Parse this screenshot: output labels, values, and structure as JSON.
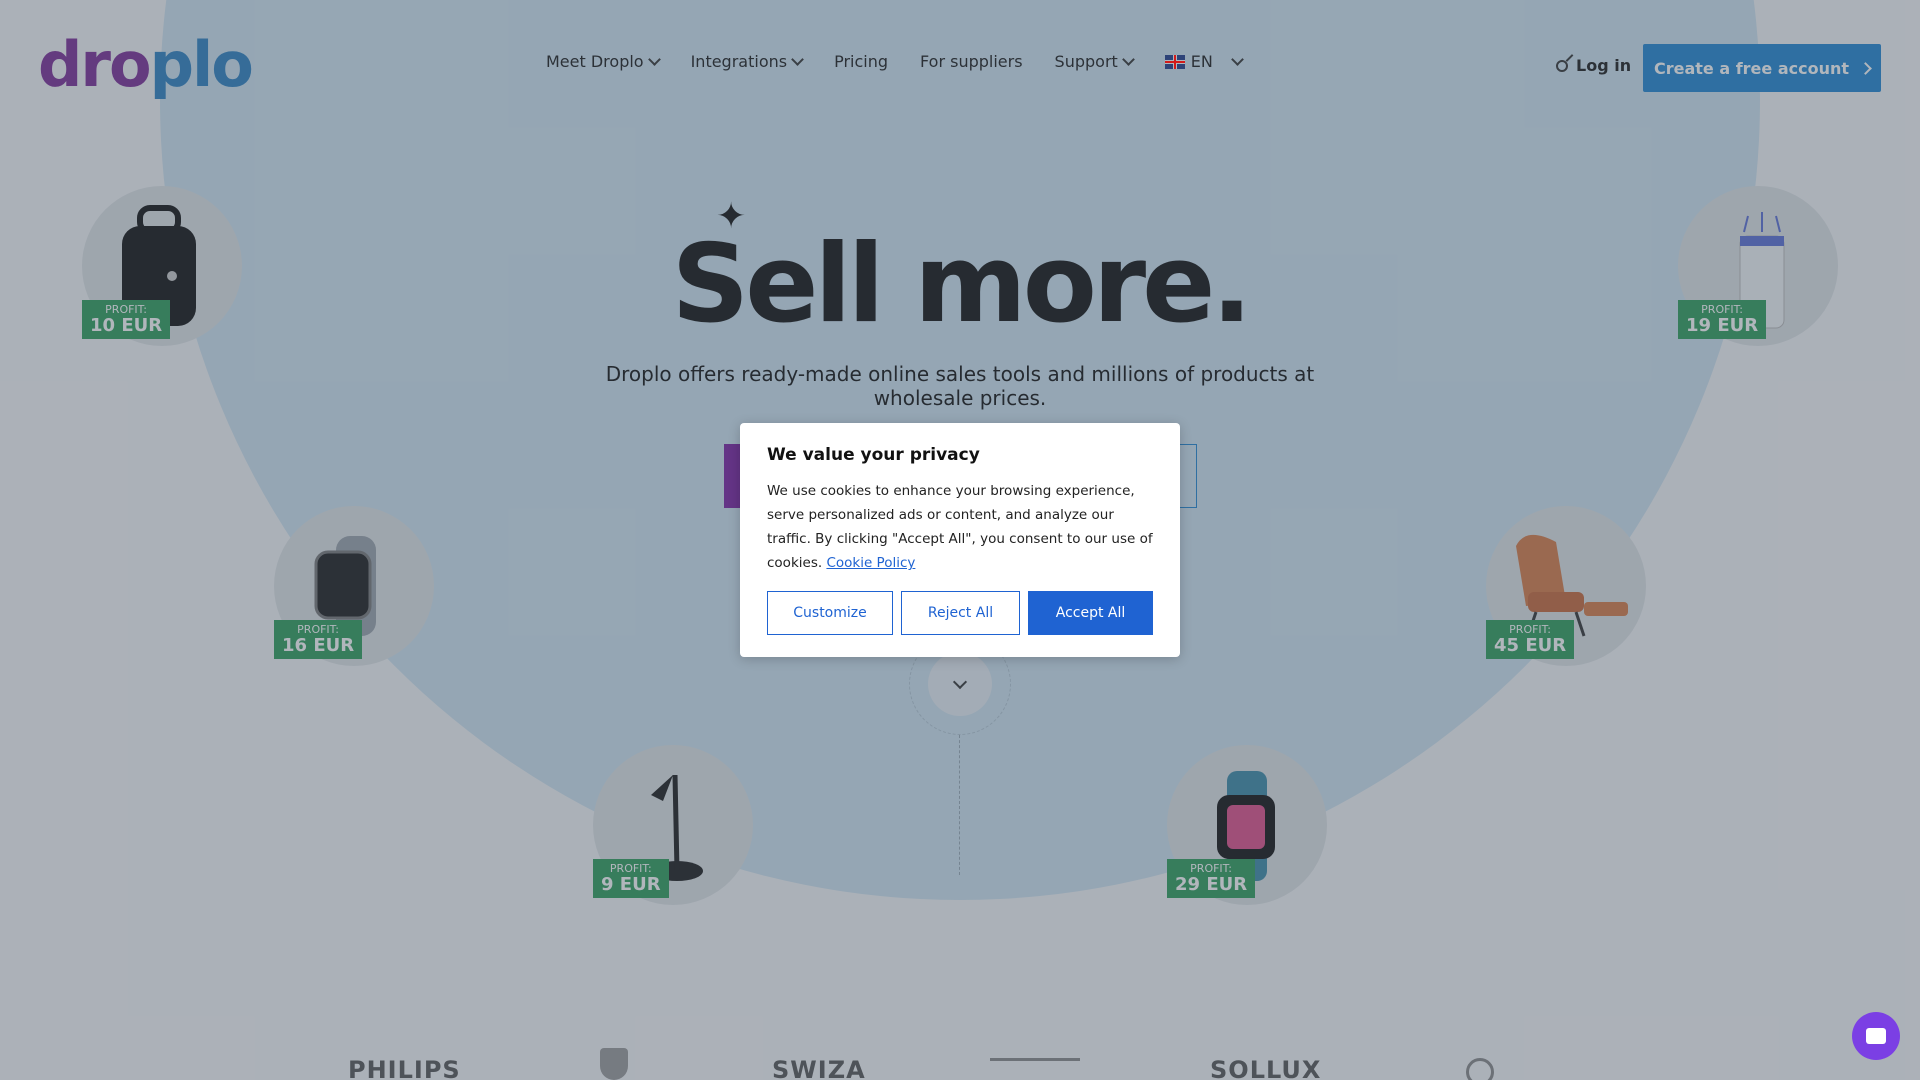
{
  "header": {
    "logo": {
      "part1": "dro",
      "part2": "plo"
    },
    "nav": [
      {
        "label": "Meet Droplo",
        "has_dropdown": true
      },
      {
        "label": "Integrations",
        "has_dropdown": true
      },
      {
        "label": "Pricing",
        "has_dropdown": false
      },
      {
        "label": "For suppliers",
        "has_dropdown": false
      },
      {
        "label": "Support",
        "has_dropdown": true
      }
    ],
    "language": "EN",
    "login_label": "Log in",
    "cta_label": "Create a free account"
  },
  "hero": {
    "title": "Sell more.",
    "subtitle": "Droplo offers ready-made online sales tools and millions of products at wholesale prices."
  },
  "products": [
    {
      "name": "backpack",
      "profit_label": "PROFIT:",
      "profit_value": "10 EUR"
    },
    {
      "name": "air purifier",
      "profit_label": "PROFIT:",
      "profit_value": "19 EUR"
    },
    {
      "name": "smartwatch grey",
      "profit_label": "PROFIT:",
      "profit_value": "16 EUR"
    },
    {
      "name": "armchair",
      "profit_label": "PROFIT:",
      "profit_value": "45 EUR"
    },
    {
      "name": "desk lamp",
      "profit_label": "PROFIT:",
      "profit_value": "9 EUR"
    },
    {
      "name": "smartwatch blue",
      "profit_label": "PROFIT:",
      "profit_value": "29 EUR"
    }
  ],
  "brands": [
    "PHILIPS",
    "SWIZA",
    "SOLLUX"
  ],
  "cookie_modal": {
    "title": "We value your privacy",
    "text": "We use cookies to enhance your browsing experience, serve personalized ads or content, and analyze our traffic. By clicking \"Accept All\", you consent to our use of cookies.",
    "link": "Cookie Policy",
    "buttons": {
      "customize": "Customize",
      "reject": "Reject All",
      "accept": "Accept All"
    }
  },
  "colors": {
    "accent": "#1f86d2",
    "brand_purple": "#7b2b96",
    "profit_green": "#2e9d5a",
    "chat": "#7b3fe4"
  }
}
